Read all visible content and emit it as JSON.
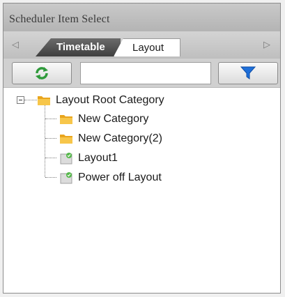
{
  "panel": {
    "title": "Scheduler Item Select"
  },
  "tabs": [
    {
      "label": "Timetable",
      "active": false
    },
    {
      "label": "Layout",
      "active": true
    }
  ],
  "toolbar": {
    "refresh_icon": "refresh-icon",
    "filter_icon": "filter-icon",
    "search_value": ""
  },
  "tree": {
    "root": {
      "label": "Layout Root Category",
      "icon": "folder-icon",
      "expanded": true
    },
    "children": [
      {
        "label": "New Category",
        "icon": "folder-icon"
      },
      {
        "label": "New Category(2)",
        "icon": "folder-icon"
      },
      {
        "label": "Layout1",
        "icon": "layout-icon"
      },
      {
        "label": "Power off Layout",
        "icon": "layout-icon"
      }
    ]
  },
  "colors": {
    "folder": "#f5b932",
    "refresh": "#2e9a3a",
    "filter": "#1e6fd9"
  }
}
